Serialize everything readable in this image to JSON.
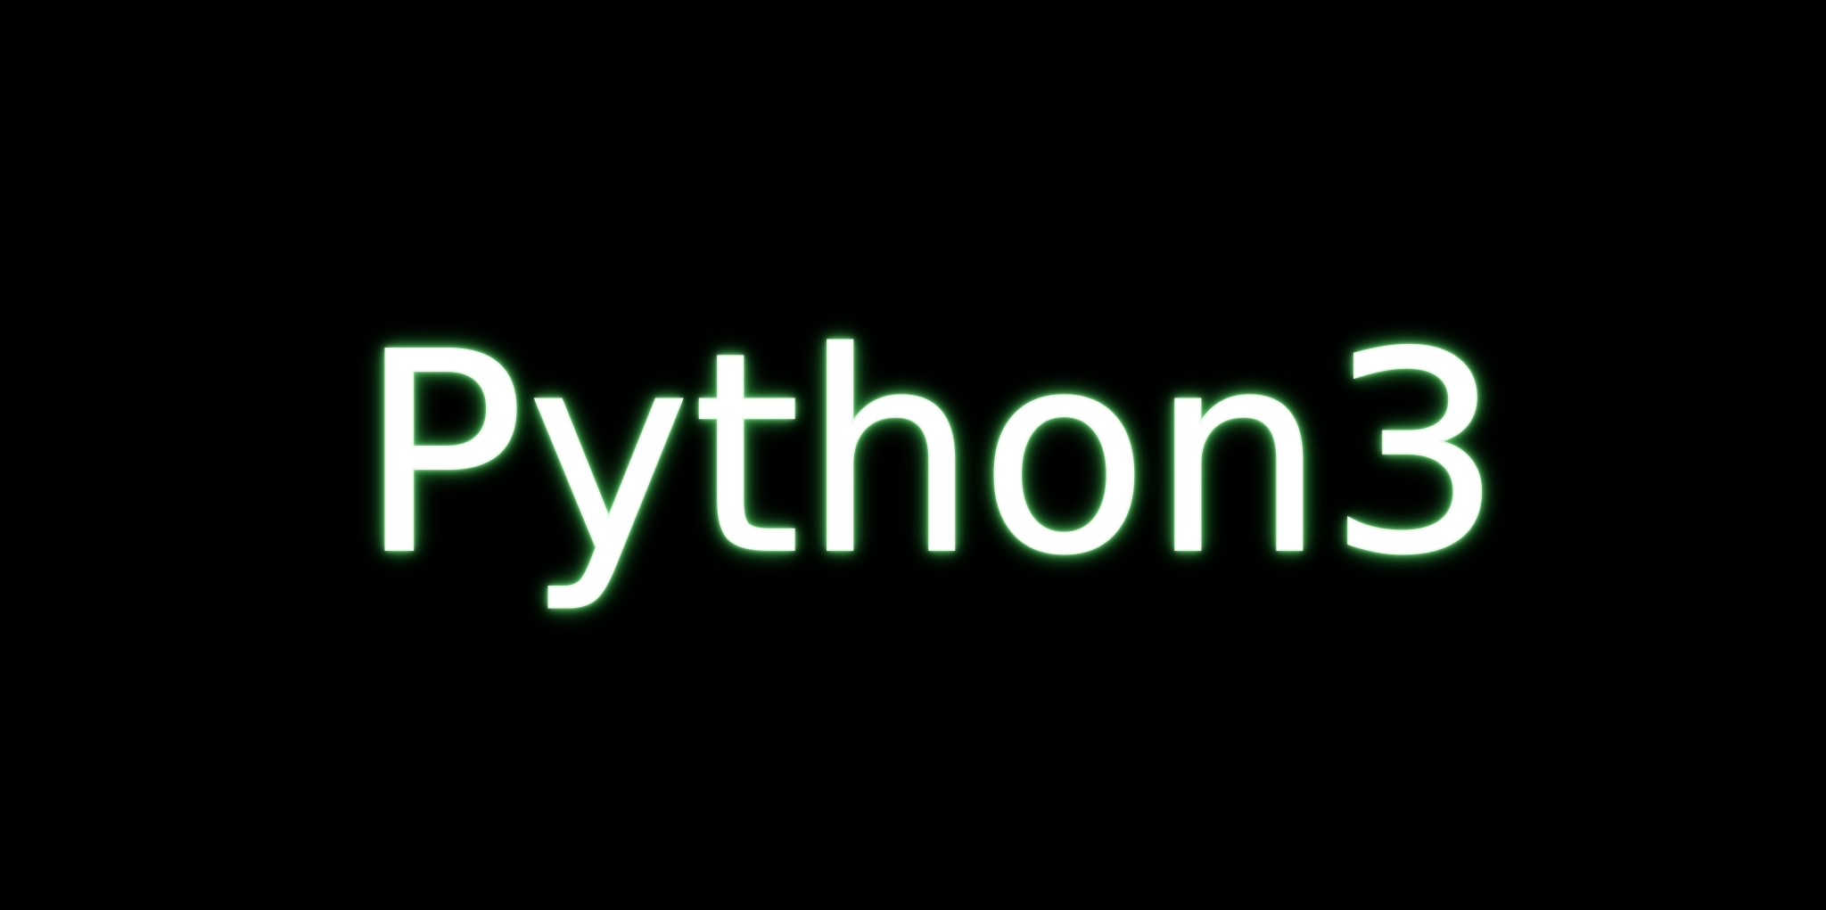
{
  "title": "Python3",
  "colors": {
    "background": "#000000",
    "text": "#ffffff",
    "glow": "#3fae4f"
  }
}
